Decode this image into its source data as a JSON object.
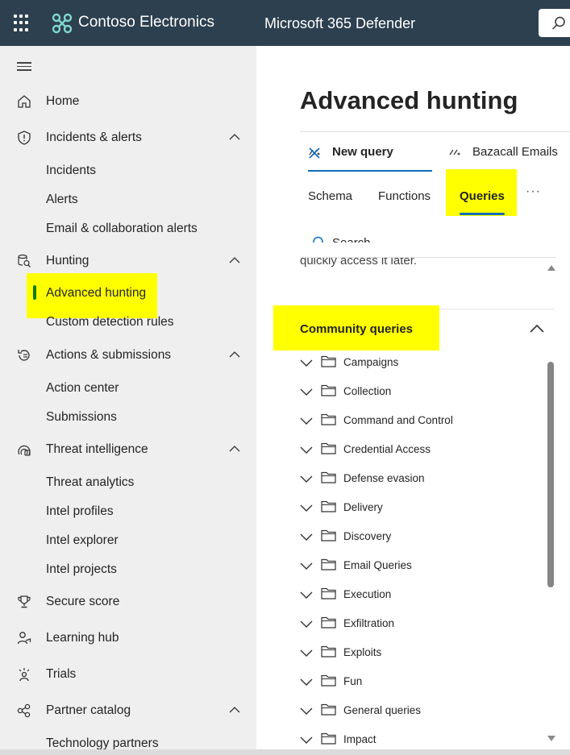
{
  "header": {
    "org_name": "Contoso Electronics",
    "product_name": "Microsoft 365 Defender",
    "bg_color": "#2d4050"
  },
  "nav": {
    "items": [
      {
        "label": "Home",
        "icon": "home-icon"
      },
      {
        "label": "Incidents & alerts",
        "icon": "shield-icon",
        "expanded": true,
        "children": [
          "Incidents",
          "Alerts",
          "Email & collaboration alerts"
        ]
      },
      {
        "label": "Hunting",
        "icon": "hunting-icon",
        "expanded": true,
        "children": [
          "Advanced hunting",
          "Custom detection rules"
        ],
        "active_child": "Advanced hunting"
      },
      {
        "label": "Actions & submissions",
        "icon": "actions-icon",
        "expanded": true,
        "children": [
          "Action center",
          "Submissions"
        ]
      },
      {
        "label": "Threat intelligence",
        "icon": "threat-intel-icon",
        "expanded": true,
        "children": [
          "Threat analytics",
          "Intel profiles",
          "Intel explorer",
          "Intel projects"
        ]
      },
      {
        "label": "Secure score",
        "icon": "trophy-icon"
      },
      {
        "label": "Learning hub",
        "icon": "learning-icon"
      },
      {
        "label": "Trials",
        "icon": "trials-icon"
      },
      {
        "label": "Partner catalog",
        "icon": "partner-icon",
        "expanded": true,
        "children": [
          "Technology partners"
        ]
      }
    ]
  },
  "main": {
    "title": "Advanced hunting",
    "query_tabs": [
      {
        "label": "New query",
        "active": true
      },
      {
        "label": "Bazacall Emails",
        "active": false
      }
    ],
    "sub_tabs": [
      "Schema",
      "Functions",
      "Queries"
    ],
    "active_sub_tab": "Queries",
    "more_label": "···",
    "search_label": "Search",
    "clipped_text": "quickly access it later.",
    "section_title": "Community queries",
    "folders": [
      "Campaigns",
      "Collection",
      "Command and Control",
      "Credential Access",
      "Defense evasion",
      "Delivery",
      "Discovery",
      "Email Queries",
      "Execution",
      "Exfiltration",
      "Exploits",
      "Fun",
      "General queries",
      "Impact"
    ]
  },
  "colors": {
    "highlight": "#ffff00",
    "accent": "#0f6cbd",
    "active_indicator": "#107c10"
  }
}
